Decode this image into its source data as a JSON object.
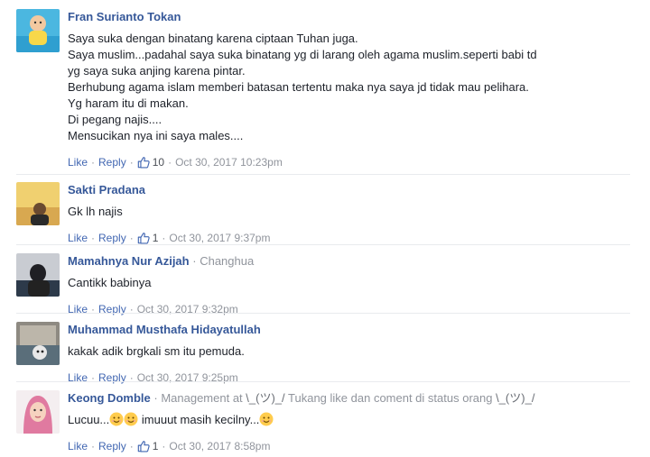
{
  "comments": [
    {
      "author": "Fran Surianto Tokan",
      "text_lines": [
        "Saya suka dengan binatang karena ciptaan Tuhan juga.",
        "Saya muslim...padahal saya suka binatang yg di larang oleh agama muslim.seperti babi td",
        "yg saya suka anjing karena pintar.",
        "Berhubung agama islam memberi batasan tertentu maka nya saya jd tidak mau pelihara.",
        "Yg haram itu di makan.",
        "Di pegang najis....",
        "Mensucikan nya ini saya males...."
      ],
      "like_label": "Like",
      "reply_label": "Reply",
      "likes": "10",
      "timestamp": "Oct 30, 2017 10:23pm"
    },
    {
      "author": "Sakti Pradana",
      "text_lines": [
        "Gk lh najis"
      ],
      "like_label": "Like",
      "reply_label": "Reply",
      "likes": "1",
      "timestamp": "Oct 30, 2017 9:37pm"
    },
    {
      "author": "Mamahnya Nur Azijah",
      "location": "Changhua",
      "text_lines": [
        "Cantikk babinya"
      ],
      "like_label": "Like",
      "reply_label": "Reply",
      "timestamp": "Oct 30, 2017 9:32pm"
    },
    {
      "author": "Muhammad Musthafa Hidayatullah",
      "text_lines": [
        "kakak adik brgkali sm itu pemuda."
      ],
      "like_label": "Like",
      "reply_label": "Reply",
      "timestamp": "Oct 30, 2017 9:25pm"
    },
    {
      "author": "Keong Domble",
      "role_prefix": "Management at",
      "shrug": "\\_(ツ)_/",
      "role_suffix": "Tukang like dan coment di status orang",
      "text_start": "Lucuu...",
      "text_end": "imuuut masih kecilny...",
      "like_label": "Like",
      "reply_label": "Reply",
      "likes": "1",
      "timestamp": "Oct 30, 2017 8:58pm"
    }
  ],
  "separator": "·",
  "icons": {
    "thumb": "thumbs-up-outline-icon",
    "emoji": "smiling-face-emoji"
  },
  "colors": {
    "author": "#365899",
    "link": "#4267b2",
    "muted": "#90949c",
    "divider": "#e9ebee"
  }
}
